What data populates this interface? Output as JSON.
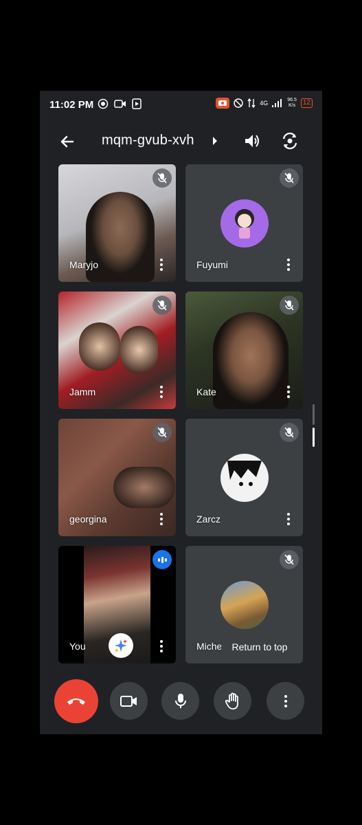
{
  "status_bar": {
    "time": "11:02 PM",
    "network": "4G",
    "speed_value": "96.5",
    "speed_unit": "K/s",
    "battery": "12"
  },
  "header": {
    "meeting_code": "mqm-gvub-xvh"
  },
  "participants": [
    {
      "name": "Maryjo",
      "video": true,
      "muted": true
    },
    {
      "name": "Fuyumi",
      "video": false,
      "muted": true
    },
    {
      "name": "Jamm",
      "video": true,
      "muted": true
    },
    {
      "name": "Kate",
      "video": true,
      "muted": true
    },
    {
      "name": "georgina",
      "video": true,
      "muted": true
    },
    {
      "name": "Zarcz",
      "video": false,
      "muted": true
    },
    {
      "name": "You",
      "video": true,
      "muted": false,
      "speaking": true
    },
    {
      "name": "Michelle",
      "video": false,
      "muted": true
    }
  ],
  "return_to_top": "Return to top",
  "colors": {
    "background": "#202124",
    "tile": "#3c4043",
    "end_call": "#ea4335",
    "active_speaker": "#1a73e8"
  },
  "icons": [
    "back-arrow-icon",
    "speaker-icon",
    "flip-camera-icon",
    "mic-off-icon",
    "more-vert-icon",
    "end-call-icon",
    "camera-icon",
    "mic-icon",
    "raise-hand-icon",
    "sparkle-icon"
  ]
}
